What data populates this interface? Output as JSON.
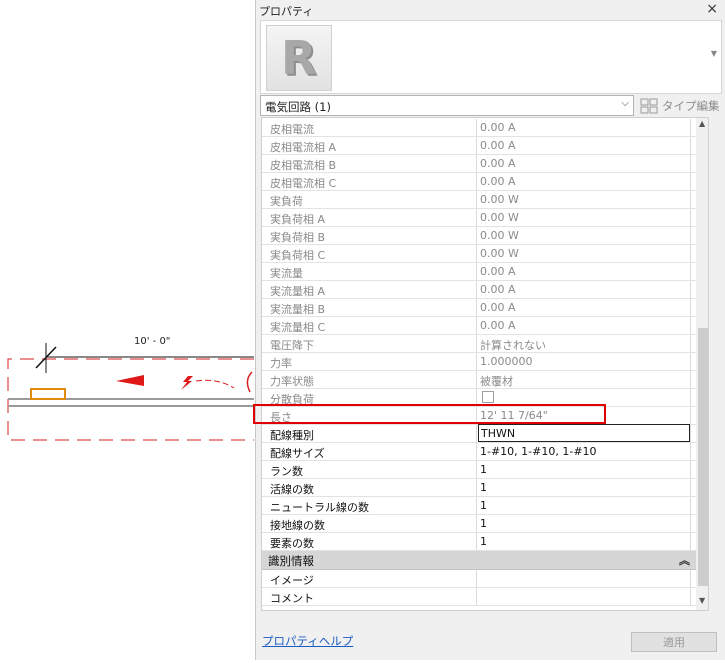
{
  "canvas": {
    "dimension_text": "10' - 0\""
  },
  "palette": {
    "title": "プロパティ",
    "close_glyph": "×",
    "type_icon": "revit-r-icon",
    "instance_selector": "電気回路 (1)",
    "edit_type_label": "タイプ編集",
    "properties": [
      {
        "name": "皮相電流",
        "value": "0.00 A",
        "editable": false
      },
      {
        "name": "皮相電流相 A",
        "value": "0.00 A",
        "editable": false
      },
      {
        "name": "皮相電流相 B",
        "value": "0.00 A",
        "editable": false
      },
      {
        "name": "皮相電流相 C",
        "value": "0.00 A",
        "editable": false
      },
      {
        "name": "実負荷",
        "value": "0.00 W",
        "editable": false
      },
      {
        "name": "実負荷相 A",
        "value": "0.00 W",
        "editable": false
      },
      {
        "name": "実負荷相 B",
        "value": "0.00 W",
        "editable": false
      },
      {
        "name": "実負荷相 C",
        "value": "0.00 W",
        "editable": false
      },
      {
        "name": "実流量",
        "value": "0.00 A",
        "editable": false
      },
      {
        "name": "実流量相 A",
        "value": "0.00 A",
        "editable": false
      },
      {
        "name": "実流量相 B",
        "value": "0.00 A",
        "editable": false
      },
      {
        "name": "実流量相 C",
        "value": "0.00 A",
        "editable": false
      },
      {
        "name": "電圧降下",
        "value": "計算されない",
        "editable": false
      },
      {
        "name": "力率",
        "value": "1.000000",
        "editable": false
      },
      {
        "name": "力率状態",
        "value": "被覆材",
        "editable": false
      },
      {
        "name": "分散負荷",
        "value": "",
        "editable": false,
        "checkbox": true
      },
      {
        "name": "長さ",
        "value": "12'  11 7/64\"",
        "editable": false
      },
      {
        "name": "配線種別",
        "value": "THWN",
        "editable": true,
        "active": true
      },
      {
        "name": "配線サイズ",
        "value": "1-#10, 1-#10, 1-#10",
        "editable": true
      },
      {
        "name": "ラン数",
        "value": "1",
        "editable": true
      },
      {
        "name": "活線の数",
        "value": "1",
        "editable": true
      },
      {
        "name": "ニュートラル線の数",
        "value": "1",
        "editable": true
      },
      {
        "name": "接地線の数",
        "value": "1",
        "editable": true
      },
      {
        "name": "要素の数",
        "value": "1",
        "editable": true
      }
    ],
    "identity_group": {
      "label": "識別情報",
      "chevron": "︽",
      "properties": [
        {
          "name": "イメージ",
          "value": ""
        },
        {
          "name": "コメント",
          "value": ""
        }
      ]
    },
    "help_link": "プロパティヘルプ",
    "apply_label": "適用"
  },
  "colors": {
    "selection": "#e00000",
    "link": "#1a5bc4",
    "readonly_text": "#8a8a8a",
    "group_header": "#d6d6d6"
  }
}
